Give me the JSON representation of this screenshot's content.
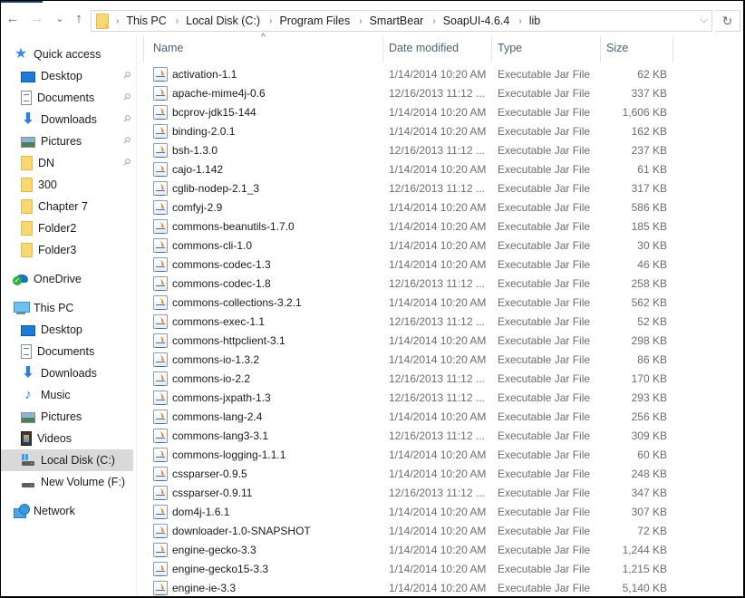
{
  "navigation": {
    "back_icon": "arrow-left-icon",
    "forward_icon": "arrow-right-icon",
    "recent_icon": "chevron-down-icon",
    "up_icon": "arrow-up-icon",
    "breadcrumbs": [
      "This PC",
      "Local Disk (C:)",
      "Program Files",
      "SmartBear",
      "SoapUI-4.6.4",
      "lib"
    ],
    "dropdown_icon": "chevron-down-icon",
    "refresh_icon": "refresh-icon",
    "back_glyph": "←",
    "forward_glyph": "→",
    "recent_glyph": "⌄",
    "up_glyph": "↑",
    "sep_glyph": "›",
    "dropdown_glyph": "⌵",
    "refresh_glyph": "↻"
  },
  "sidebar": {
    "quick_access": {
      "label": "Quick access",
      "items": [
        {
          "label": "Desktop",
          "icon": "desktop-icon",
          "pinned": true
        },
        {
          "label": "Documents",
          "icon": "documents-icon",
          "pinned": true
        },
        {
          "label": "Downloads",
          "icon": "downloads-icon",
          "pinned": true
        },
        {
          "label": "Pictures",
          "icon": "pictures-icon",
          "pinned": true
        },
        {
          "label": "DN",
          "icon": "folder-icon",
          "pinned": true
        },
        {
          "label": "300",
          "icon": "folder-icon",
          "pinned": false
        },
        {
          "label": "Chapter 7",
          "icon": "folder-icon",
          "pinned": false
        },
        {
          "label": "Folder2",
          "icon": "folder-icon",
          "pinned": false
        },
        {
          "label": "Folder3",
          "icon": "folder-icon",
          "pinned": false
        }
      ]
    },
    "onedrive": {
      "label": "OneDrive"
    },
    "this_pc": {
      "label": "This PC",
      "items": [
        {
          "label": "Desktop",
          "icon": "desktop-icon"
        },
        {
          "label": "Documents",
          "icon": "documents-icon"
        },
        {
          "label": "Downloads",
          "icon": "downloads-icon"
        },
        {
          "label": "Music",
          "icon": "music-icon"
        },
        {
          "label": "Pictures",
          "icon": "pictures-icon"
        },
        {
          "label": "Videos",
          "icon": "videos-icon"
        },
        {
          "label": "Local Disk (C:)",
          "icon": "local-disk-icon",
          "selected": true
        },
        {
          "label": "New Volume (F:)",
          "icon": "drive-icon"
        }
      ]
    },
    "network": {
      "label": "Network"
    }
  },
  "columns": {
    "name": "Name",
    "date": "Date modified",
    "type": "Type",
    "size": "Size",
    "sort_indicator": "^"
  },
  "files": [
    {
      "name": "activation-1.1",
      "date": "1/14/2014 10:20 AM",
      "type": "Executable Jar File",
      "size": "62 KB"
    },
    {
      "name": "apache-mime4j-0.6",
      "date": "12/16/2013 11:12 ...",
      "type": "Executable Jar File",
      "size": "337 KB"
    },
    {
      "name": "bcprov-jdk15-144",
      "date": "1/14/2014 10:20 AM",
      "type": "Executable Jar File",
      "size": "1,606 KB"
    },
    {
      "name": "binding-2.0.1",
      "date": "1/14/2014 10:20 AM",
      "type": "Executable Jar File",
      "size": "162 KB"
    },
    {
      "name": "bsh-1.3.0",
      "date": "12/16/2013 11:12 ...",
      "type": "Executable Jar File",
      "size": "237 KB"
    },
    {
      "name": "cajo-1.142",
      "date": "1/14/2014 10:20 AM",
      "type": "Executable Jar File",
      "size": "61 KB"
    },
    {
      "name": "cglib-nodep-2.1_3",
      "date": "12/16/2013 11:12 ...",
      "type": "Executable Jar File",
      "size": "317 KB"
    },
    {
      "name": "comfyj-2.9",
      "date": "1/14/2014 10:20 AM",
      "type": "Executable Jar File",
      "size": "586 KB"
    },
    {
      "name": "commons-beanutils-1.7.0",
      "date": "1/14/2014 10:20 AM",
      "type": "Executable Jar File",
      "size": "185 KB"
    },
    {
      "name": "commons-cli-1.0",
      "date": "1/14/2014 10:20 AM",
      "type": "Executable Jar File",
      "size": "30 KB"
    },
    {
      "name": "commons-codec-1.3",
      "date": "1/14/2014 10:20 AM",
      "type": "Executable Jar File",
      "size": "46 KB"
    },
    {
      "name": "commons-codec-1.8",
      "date": "12/16/2013 11:12 ...",
      "type": "Executable Jar File",
      "size": "258 KB"
    },
    {
      "name": "commons-collections-3.2.1",
      "date": "1/14/2014 10:20 AM",
      "type": "Executable Jar File",
      "size": "562 KB"
    },
    {
      "name": "commons-exec-1.1",
      "date": "12/16/2013 11:12 ...",
      "type": "Executable Jar File",
      "size": "52 KB"
    },
    {
      "name": "commons-httpclient-3.1",
      "date": "1/14/2014 10:20 AM",
      "type": "Executable Jar File",
      "size": "298 KB"
    },
    {
      "name": "commons-io-1.3.2",
      "date": "1/14/2014 10:20 AM",
      "type": "Executable Jar File",
      "size": "86 KB"
    },
    {
      "name": "commons-io-2.2",
      "date": "12/16/2013 11:12 ...",
      "type": "Executable Jar File",
      "size": "170 KB"
    },
    {
      "name": "commons-jxpath-1.3",
      "date": "12/16/2013 11:12 ...",
      "type": "Executable Jar File",
      "size": "293 KB"
    },
    {
      "name": "commons-lang-2.4",
      "date": "1/14/2014 10:20 AM",
      "type": "Executable Jar File",
      "size": "256 KB"
    },
    {
      "name": "commons-lang3-3.1",
      "date": "12/16/2013 11:12 ...",
      "type": "Executable Jar File",
      "size": "309 KB"
    },
    {
      "name": "commons-logging-1.1.1",
      "date": "1/14/2014 10:20 AM",
      "type": "Executable Jar File",
      "size": "60 KB"
    },
    {
      "name": "cssparser-0.9.5",
      "date": "1/14/2014 10:20 AM",
      "type": "Executable Jar File",
      "size": "248 KB"
    },
    {
      "name": "cssparser-0.9.11",
      "date": "12/16/2013 11:12 ...",
      "type": "Executable Jar File",
      "size": "347 KB"
    },
    {
      "name": "dom4j-1.6.1",
      "date": "1/14/2014 10:20 AM",
      "type": "Executable Jar File",
      "size": "307 KB"
    },
    {
      "name": "downloader-1.0-SNAPSHOT",
      "date": "1/14/2014 10:20 AM",
      "type": "Executable Jar File",
      "size": "72 KB"
    },
    {
      "name": "engine-gecko-3.3",
      "date": "1/14/2014 10:20 AM",
      "type": "Executable Jar File",
      "size": "1,244 KB"
    },
    {
      "name": "engine-gecko15-3.3",
      "date": "1/14/2014 10:20 AM",
      "type": "Executable Jar File",
      "size": "1,215 KB"
    },
    {
      "name": "engine-ie-3.3",
      "date": "1/14/2014 10:20 AM",
      "type": "Executable Jar File",
      "size": "5,140 KB"
    }
  ]
}
